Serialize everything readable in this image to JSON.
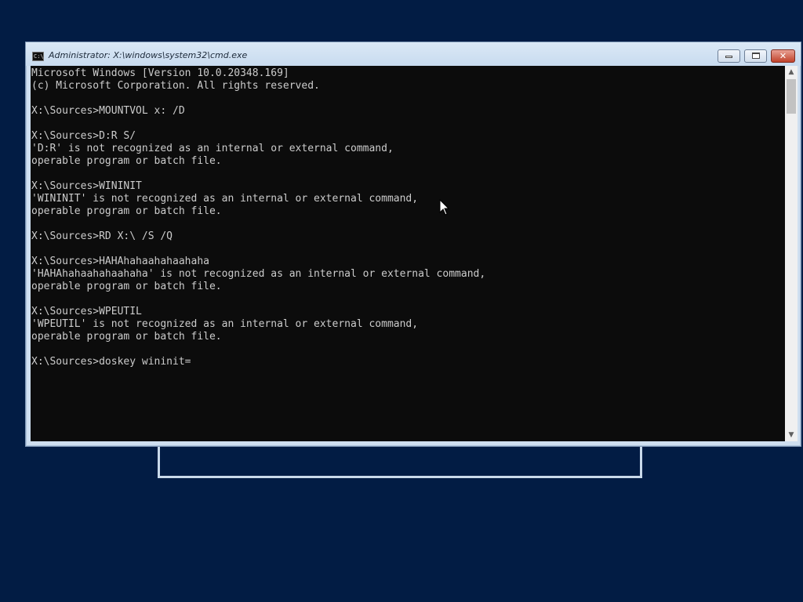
{
  "window": {
    "title": "Administrator: X:\\windows\\system32\\cmd.exe",
    "icon_text": "C:\\",
    "minimize_label": "",
    "close_label": "✕"
  },
  "console": {
    "lines": [
      "Microsoft Windows [Version 10.0.20348.169]",
      "(c) Microsoft Corporation. All rights reserved.",
      "",
      "X:\\Sources>MOUNTVOL x: /D",
      "",
      "X:\\Sources>D:R S/",
      "'D:R' is not recognized as an internal or external command,",
      "operable program or batch file.",
      "",
      "X:\\Sources>WININIT",
      "'WININIT' is not recognized as an internal or external command,",
      "operable program or batch file.",
      "",
      "X:\\Sources>RD X:\\ /S /Q",
      "",
      "X:\\Sources>HAHAhahaahahaahaha",
      "'HAHAhahaahahaahaha' is not recognized as an internal or external command,",
      "operable program or batch file.",
      "",
      "X:\\Sources>WPEUTIL",
      "'WPEUTIL' is not recognized as an internal or external command,",
      "operable program or batch file.",
      "",
      "X:\\Sources>doskey wininit="
    ]
  },
  "scrollbar": {
    "up_icon": "▲",
    "down_icon": "▼"
  },
  "colors": {
    "desktop": "#021c44",
    "console_bg": "#0c0c0c",
    "console_text": "#cccccc"
  }
}
